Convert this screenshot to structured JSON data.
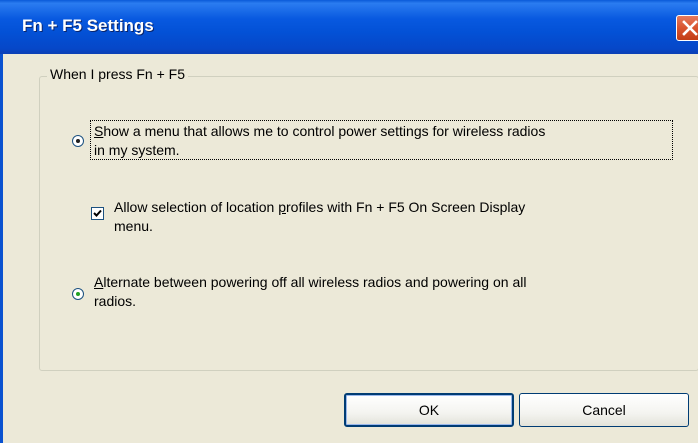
{
  "window": {
    "title": "Fn + F5 Settings"
  },
  "group": {
    "label": "When I press Fn + F5"
  },
  "options": {
    "show_menu": {
      "line1_accel": "S",
      "line1_rest": "how a menu that allows me to control power settings for wireless radios",
      "line2": "in my system.",
      "selected": true
    },
    "location_profiles": {
      "line1_pre": "Allow selection of location ",
      "line1_accel": "p",
      "line1_rest": "rofiles with Fn + F5 On Screen Display",
      "line2": "menu.",
      "checked": true
    },
    "alternate": {
      "line1_accel": "A",
      "line1_rest": "lternate between powering off all wireless radios and powering on all",
      "line2": "radios.",
      "selected": false
    }
  },
  "buttons": {
    "ok": "OK",
    "cancel": "Cancel"
  },
  "colors": {
    "titlebar": "#0351d6",
    "close": "#d9542f",
    "face": "#ece9d8"
  },
  "icons": {
    "close": "close-icon",
    "check": "checkmark-icon"
  }
}
